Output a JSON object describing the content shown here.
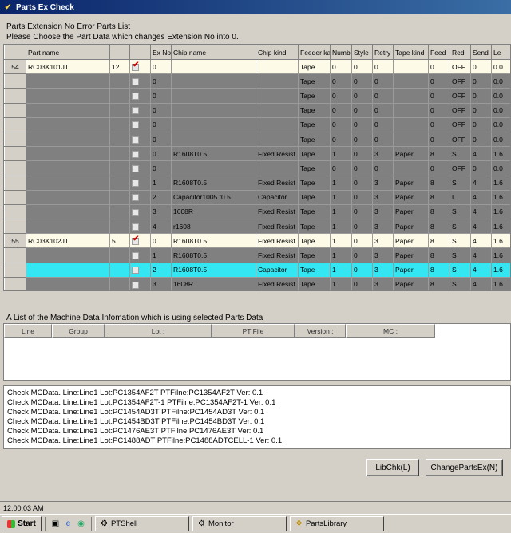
{
  "window": {
    "title": "Parts Ex Check"
  },
  "info": {
    "line1": "Parts Extension No Error Parts List",
    "line2": "Please Choose the Part Data which changes Extension No into 0."
  },
  "grid": {
    "columns": [
      "",
      "Part name",
      "",
      "",
      "Ex No",
      "Chip name",
      "Chip kind",
      "Feeder ka",
      "Numb",
      "Style",
      "Retry",
      "Tape kind",
      "Feed",
      "Redi",
      "Send",
      "Le"
    ],
    "rows": [
      {
        "type": "parent",
        "idx": "54",
        "part": "RC03K101JT",
        "qty": "12",
        "checked": true,
        "ex": "0",
        "chip": "",
        "kind": "",
        "feeder": "Tape",
        "num": "0",
        "style": "0",
        "retry": "0",
        "tape": "",
        "feed": "0",
        "redi": "OFF",
        "send": "0",
        "le": "0.0"
      },
      {
        "type": "child",
        "idx": "",
        "part": "",
        "qty": "",
        "checked": false,
        "ex": "0",
        "chip": "",
        "kind": "",
        "feeder": "Tape",
        "num": "0",
        "style": "0",
        "retry": "0",
        "tape": "",
        "feed": "0",
        "redi": "OFF",
        "send": "0",
        "le": "0.0"
      },
      {
        "type": "child",
        "idx": "",
        "part": "",
        "qty": "",
        "checked": false,
        "ex": "0",
        "chip": "",
        "kind": "",
        "feeder": "Tape",
        "num": "0",
        "style": "0",
        "retry": "0",
        "tape": "",
        "feed": "0",
        "redi": "OFF",
        "send": "0",
        "le": "0.0"
      },
      {
        "type": "child",
        "idx": "",
        "part": "",
        "qty": "",
        "checked": false,
        "ex": "0",
        "chip": "",
        "kind": "",
        "feeder": "Tape",
        "num": "0",
        "style": "0",
        "retry": "0",
        "tape": "",
        "feed": "0",
        "redi": "OFF",
        "send": "0",
        "le": "0.0"
      },
      {
        "type": "child",
        "idx": "",
        "part": "",
        "qty": "",
        "checked": false,
        "ex": "0",
        "chip": "",
        "kind": "",
        "feeder": "Tape",
        "num": "0",
        "style": "0",
        "retry": "0",
        "tape": "",
        "feed": "0",
        "redi": "OFF",
        "send": "0",
        "le": "0.0"
      },
      {
        "type": "child",
        "idx": "",
        "part": "",
        "qty": "",
        "checked": false,
        "ex": "0",
        "chip": "",
        "kind": "",
        "feeder": "Tape",
        "num": "0",
        "style": "0",
        "retry": "0",
        "tape": "",
        "feed": "0",
        "redi": "OFF",
        "send": "0",
        "le": "0.0"
      },
      {
        "type": "child",
        "idx": "",
        "part": "",
        "qty": "",
        "checked": false,
        "ex": "0",
        "chip": "R1608T0.5",
        "kind": "Fixed Resist",
        "feeder": "Tape",
        "num": "1",
        "style": "0",
        "retry": "3",
        "tape": "Paper",
        "feed": "8",
        "redi": "S",
        "send": "4",
        "le": "1.6"
      },
      {
        "type": "child",
        "idx": "",
        "part": "",
        "qty": "",
        "checked": false,
        "ex": "0",
        "chip": "",
        "kind": "",
        "feeder": "Tape",
        "num": "0",
        "style": "0",
        "retry": "0",
        "tape": "",
        "feed": "0",
        "redi": "OFF",
        "send": "0",
        "le": "0.0"
      },
      {
        "type": "child",
        "idx": "",
        "part": "",
        "qty": "",
        "checked": false,
        "ex": "1",
        "chip": "R1608T0.5",
        "kind": "Fixed Resist",
        "feeder": "Tape",
        "num": "1",
        "style": "0",
        "retry": "3",
        "tape": "Paper",
        "feed": "8",
        "redi": "S",
        "send": "4",
        "le": "1.6"
      },
      {
        "type": "child",
        "idx": "",
        "part": "",
        "qty": "",
        "checked": false,
        "ex": "2",
        "chip": "Capacitor1005 t0.5",
        "kind": "Capacitor",
        "feeder": "Tape",
        "num": "1",
        "style": "0",
        "retry": "3",
        "tape": "Paper",
        "feed": "8",
        "redi": "L",
        "send": "4",
        "le": "1.6"
      },
      {
        "type": "child",
        "idx": "",
        "part": "",
        "qty": "",
        "checked": false,
        "ex": "3",
        "chip": "1608R",
        "kind": "Fixed Resist",
        "feeder": "Tape",
        "num": "1",
        "style": "0",
        "retry": "3",
        "tape": "Paper",
        "feed": "8",
        "redi": "S",
        "send": "4",
        "le": "1.6"
      },
      {
        "type": "child",
        "idx": "",
        "part": "",
        "qty": "",
        "checked": false,
        "ex": "4",
        "chip": "r1608",
        "kind": "Fixed Resist",
        "feeder": "Tape",
        "num": "1",
        "style": "0",
        "retry": "3",
        "tape": "Paper",
        "feed": "8",
        "redi": "S",
        "send": "4",
        "le": "1.6"
      },
      {
        "type": "parent",
        "idx": "55",
        "part": "RC03K102JT",
        "qty": "5",
        "checked": true,
        "ex": "0",
        "chip": "R1608T0.5",
        "kind": "Fixed Resist",
        "feeder": "Tape",
        "num": "1",
        "style": "0",
        "retry": "3",
        "tape": "Paper",
        "feed": "8",
        "redi": "S",
        "send": "4",
        "le": "1.6"
      },
      {
        "type": "child",
        "idx": "",
        "part": "",
        "qty": "",
        "checked": false,
        "ex": "1",
        "chip": "R1608T0.5",
        "kind": "Fixed Resist",
        "feeder": "Tape",
        "num": "1",
        "style": "0",
        "retry": "3",
        "tape": "Paper",
        "feed": "8",
        "redi": "S",
        "send": "4",
        "le": "1.6"
      },
      {
        "type": "sel",
        "idx": "",
        "part": "",
        "qty": "",
        "checked": false,
        "ex": "2",
        "chip": "R1608T0.5",
        "kind": "Capacitor",
        "feeder": "Tape",
        "num": "1",
        "style": "0",
        "retry": "3",
        "tape": "Paper",
        "feed": "8",
        "redi": "S",
        "send": "4",
        "le": "1.6"
      },
      {
        "type": "child",
        "idx": "",
        "part": "",
        "qty": "",
        "checked": false,
        "ex": "3",
        "chip": "1608R",
        "kind": "Fixed Resist",
        "feeder": "Tape",
        "num": "1",
        "style": "0",
        "retry": "3",
        "tape": "Paper",
        "feed": "8",
        "redi": "S",
        "send": "4",
        "le": "1.6"
      }
    ]
  },
  "machine": {
    "label": "A List of the Machine Data Infomation which is using selected Parts Data",
    "columns": [
      "Line",
      "Group",
      "Lot :",
      "PT File",
      "Version :",
      "MC :"
    ]
  },
  "log": [
    "Check MCData. Line:Line1 Lot:PC1354AF2T PTFilne:PC1354AF2T Ver: 0.1",
    "Check MCData. Line:Line1 Lot:PC1354AF2T-1 PTFilne:PC1354AF2T-1 Ver: 0.1",
    "Check MCData. Line:Line1 Lot:PC1454AD3T PTFilne:PC1454AD3T Ver: 0.1",
    "Check MCData. Line:Line1 Lot:PC1454BD3T PTFilne:PC1454BD3T Ver: 0.1",
    "Check MCData. Line:Line1 Lot:PC1476AE3T PTFilne:PC1476AE3T Ver: 0.1",
    "Check MCData. Line:Line1 Lot:PC1488ADT PTFilne:PC1488ADTCELL-1 Ver: 0.1"
  ],
  "buttons": {
    "libchk": "LibChk(L)",
    "change": "ChangePartsEx(N)"
  },
  "status": {
    "time": "12:00:03 AM"
  },
  "taskbar": {
    "start": "Start",
    "tasks": [
      "PTShell",
      "Monitor",
      "PartsLibrary"
    ]
  }
}
